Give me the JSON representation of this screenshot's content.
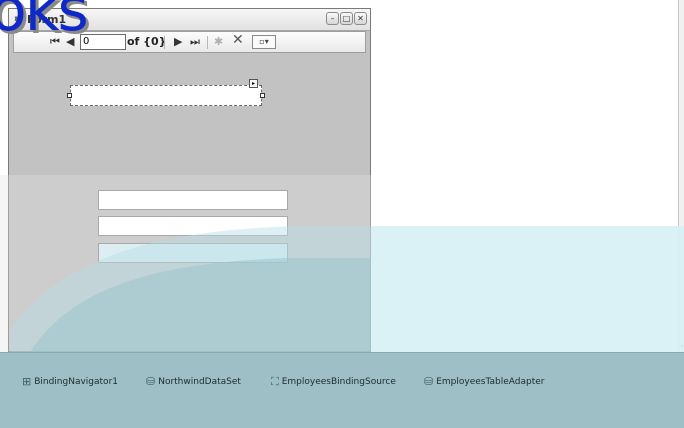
{
  "form": {
    "title": "Form1",
    "icon": "form-icon",
    "window_buttons": [
      "minimize-icon",
      "maximize-icon",
      "close-icon"
    ]
  },
  "navigator": {
    "position_value": "0",
    "of_label": "of {0}",
    "icons": [
      "move-first-icon",
      "move-previous-icon",
      "move-next-icon",
      "move-last-icon",
      "add-new-icon",
      "delete-icon",
      "dropdown-icon"
    ]
  },
  "logo": {
    "text": "oks"
  },
  "tray": {
    "items": [
      {
        "label": "BindingNavigator1",
        "icon": "binding-navigator-icon"
      },
      {
        "label": "NorthwindDataSet",
        "icon": "dataset-icon"
      },
      {
        "label": "EmployeesBindingSource",
        "icon": "binding-source-icon"
      },
      {
        "label": "EmployeesTableAdapter",
        "icon": "table-adapter-icon"
      }
    ]
  },
  "colors": {
    "logo_blue": "#0f29c8",
    "tray_teal": "#9ebfc6",
    "form_gray": "#c2c2c2"
  }
}
